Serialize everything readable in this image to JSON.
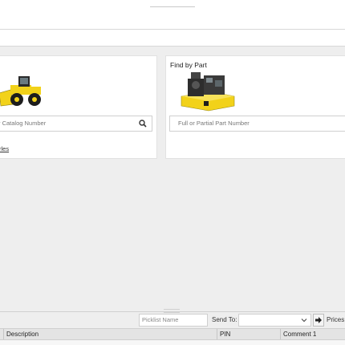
{
  "find_by_part": {
    "title": "Find by Part",
    "placeholder": "Full or Partial Part Number"
  },
  "find_by_model": {
    "placeholder_visible": "r Catalog Number",
    "link_visible": "rles"
  },
  "picklist": {
    "name_placeholder": "Picklist Name",
    "send_to_label": "Send To:",
    "send_to_value": "",
    "prices_label": "Prices:"
  },
  "table": {
    "columns": [
      "Description",
      "PIN",
      "Comment 1"
    ]
  },
  "colors": {
    "machine_yellow": "#f2d21a",
    "machine_black": "#1d1d1d",
    "accent_green": "#367c2b"
  }
}
